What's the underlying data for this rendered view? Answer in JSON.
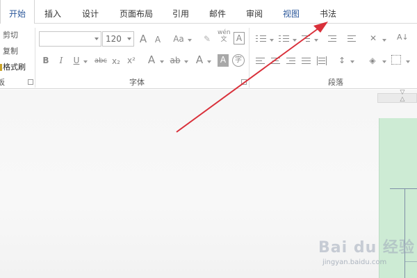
{
  "tabs": [
    {
      "label": "开始",
      "active": true
    },
    {
      "label": "插入"
    },
    {
      "label": "设计"
    },
    {
      "label": "页面布局"
    },
    {
      "label": "引用"
    },
    {
      "label": "邮件"
    },
    {
      "label": "审阅"
    },
    {
      "label": "视图"
    },
    {
      "label": "书法"
    }
  ],
  "clipboard": {
    "cut": "剪切",
    "copy": "复制",
    "format_painter": "格式刷",
    "group_label": "板"
  },
  "font": {
    "family_value": "",
    "size_value": "120",
    "group_label": "字体",
    "icons": [
      "grow-font",
      "shrink-font",
      "change-case",
      "clear-format",
      "phonetic-guide",
      "char-border",
      "bold",
      "italic",
      "underline",
      "strikethrough",
      "subscript",
      "superscript",
      "text-effect",
      "highlight",
      "font-color",
      "char-shading",
      "enclose-char"
    ],
    "glyphs": {
      "grow": "A",
      "shrink": "A",
      "case": "Aa",
      "phonetic_top": "wén",
      "phonetic_bottom": "文",
      "border": "A",
      "bold": "B",
      "italic": "I",
      "underline": "U",
      "strike": "abc",
      "sub": "x₂",
      "sup": "x²",
      "effect": "A",
      "highlight": "ab",
      "color": "A",
      "shading": "A",
      "enclose": "字"
    }
  },
  "paragraph": {
    "group_label": "段落"
  },
  "watermark": {
    "logo": "Bai du 经验",
    "url": "jingyan.baidu.com"
  },
  "colors": {
    "accent": "#2b579a",
    "arrow": "#d9303a",
    "page_green": "#cdebd4"
  }
}
